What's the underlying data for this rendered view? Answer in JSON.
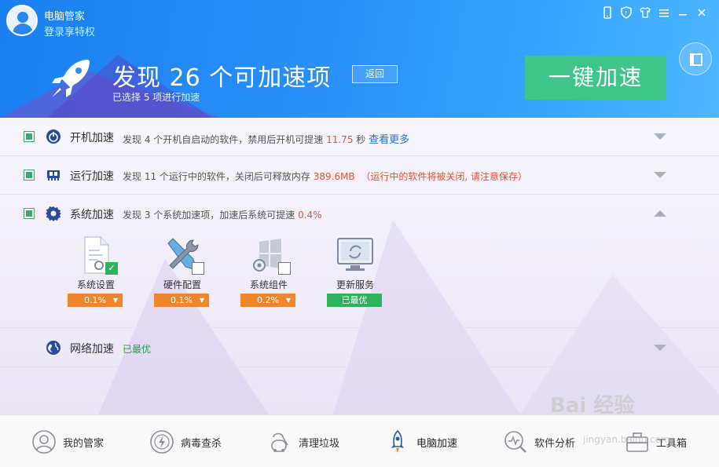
{
  "header": {
    "app_title": "电脑管家",
    "login_link": "登录享特权",
    "headline": "发现 26 个可加速项",
    "sub_headline": "已选择 5 项进行加速",
    "back_button": "返回",
    "accelerate_button": "一键加速",
    "window_controls": [
      "phone-icon",
      "shield-icon",
      "shirt-icon",
      "menu-icon",
      "minimize-icon",
      "close-icon"
    ]
  },
  "rows": [
    {
      "title": "开机加速",
      "desc_pre": "发现 4 个开机自启动的软件，禁用后开机可提速 ",
      "highlight": "11.75",
      "desc_post": " 秒 ",
      "more": "查看更多",
      "icon": "power-icon"
    },
    {
      "title": "运行加速",
      "desc_pre": "发现 11 个运行中的软件，关闭后可释放内存 ",
      "highlight": "389.6MB",
      "warning": "（运行中的软件将被关闭, 请注意保存）",
      "icon": "memory-chip-icon"
    },
    {
      "title": "系统加速",
      "desc_pre": "发现 3 个系统加速项，加速后系统可提速 ",
      "highlight": "0.4%",
      "icon": "gear-icon",
      "items": [
        {
          "name": "系统设置",
          "value": "0.1%",
          "checked": true,
          "icon": "settings-document-icon"
        },
        {
          "name": "硬件配置",
          "value": "0.1%",
          "checked": false,
          "icon": "tools-icon"
        },
        {
          "name": "系统组件",
          "value": "0.2%",
          "checked": false,
          "icon": "windows-gear-icon"
        },
        {
          "name": "更新服务",
          "value": "已最优",
          "icon": "monitor-refresh-icon"
        }
      ]
    },
    {
      "title": "网络加速",
      "status": "已最优",
      "icon": "globe-icon"
    }
  ],
  "nav": [
    {
      "label": "我的管家",
      "icon": "avatar-icon"
    },
    {
      "label": "病毒查杀",
      "icon": "lightning-shield-icon"
    },
    {
      "label": "清理垃圾",
      "icon": "vacuum-icon"
    },
    {
      "label": "电脑加速",
      "icon": "rocket-icon",
      "active": true
    },
    {
      "label": "软件分析",
      "icon": "analysis-icon"
    },
    {
      "label": "工具箱",
      "icon": "toolbox-icon"
    }
  ],
  "watermark": {
    "main": "Bai  经验",
    "sub": "jingyan.baidu.com"
  },
  "colors": {
    "header_blue": "#1a7ff0",
    "accelerate_green": "#3ec58a",
    "highlight_red": "#e8502c",
    "pill_orange": "#f0862c",
    "ok_green": "#2fb25e"
  }
}
